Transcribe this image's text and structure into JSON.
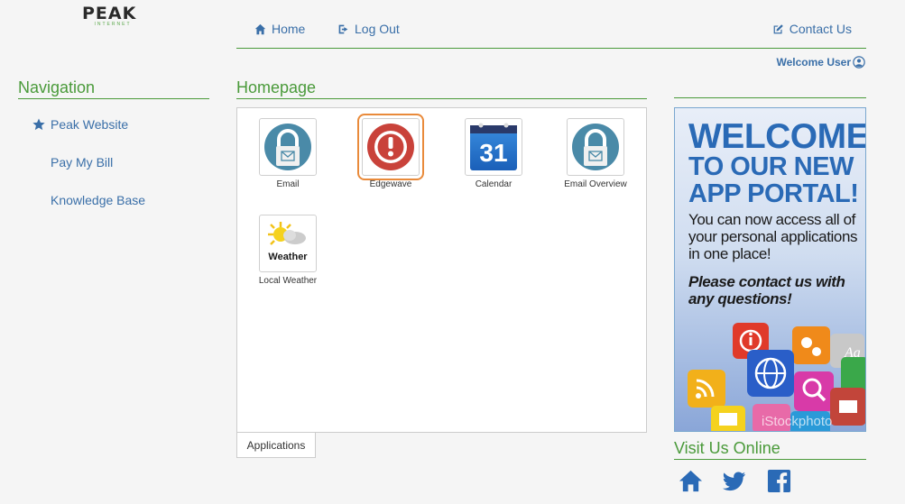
{
  "logo": {
    "text": "PEAK",
    "sub": "INTERNET"
  },
  "topnav": {
    "home": "Home",
    "logout": "Log Out",
    "contact": "Contact Us"
  },
  "user": {
    "welcome": "Welcome User"
  },
  "navigation": {
    "title": "Navigation",
    "items": [
      {
        "label": "Peak Website",
        "icon": "star-icon"
      },
      {
        "label": "Pay My Bill"
      },
      {
        "label": "Knowledge Base"
      }
    ]
  },
  "homepage": {
    "title": "Homepage",
    "apps": [
      {
        "label": "Email",
        "icon": "mail-lock-icon"
      },
      {
        "label": "Edgewave",
        "icon": "alert-icon",
        "selected": true
      },
      {
        "label": "Calendar",
        "icon": "calendar-icon",
        "day": "31"
      },
      {
        "label": "Email Overview",
        "icon": "mail-lock-icon"
      },
      {
        "label": "Local Weather",
        "icon": "weather-icon",
        "badge": "Weather"
      }
    ],
    "tab": "Applications"
  },
  "banner": {
    "line1": "WELCOME",
    "line2": "TO OUR NEW APP PORTAL!",
    "body": "You can now access all of your personal applications in one place!",
    "cta": "Please contact us with any questions!",
    "watermark": "iStockphoto"
  },
  "visit": {
    "title": "Visit Us Online",
    "icons": [
      "home-icon",
      "twitter-icon",
      "facebook-icon"
    ]
  },
  "colors": {
    "accent_green": "#4a9a3a",
    "link_blue": "#3a6fa8",
    "selection_orange": "#e98a3a"
  }
}
